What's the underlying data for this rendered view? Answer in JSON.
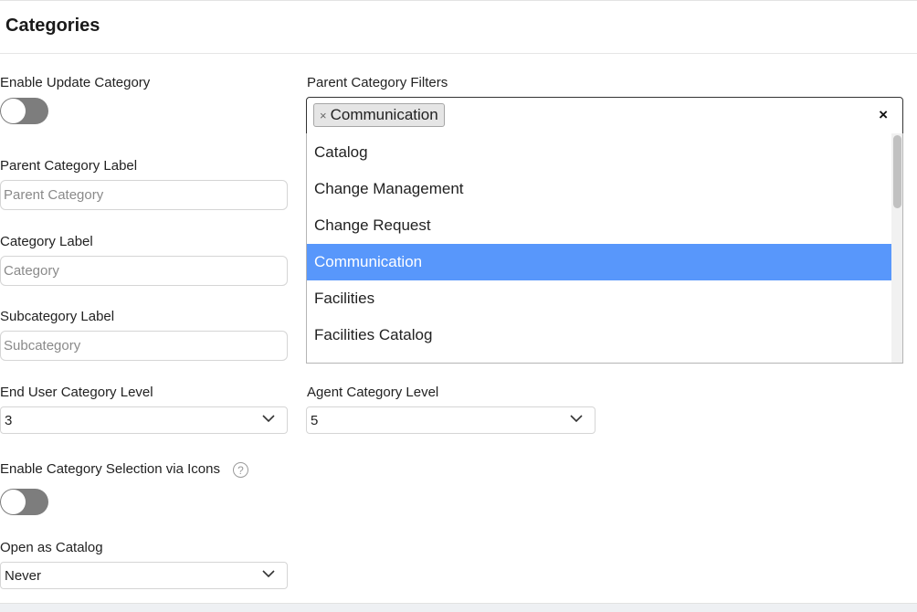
{
  "header": {
    "title": "Categories"
  },
  "enable_update_category": {
    "label": "Enable Update Category",
    "enabled": false
  },
  "parent_category_label": {
    "label": "Parent Category Label",
    "placeholder": "Parent Category",
    "value": ""
  },
  "category_label": {
    "label": "Category Label",
    "placeholder": "Category",
    "value": ""
  },
  "subcategory_label": {
    "label": "Subcategory Label",
    "placeholder": "Subcategory",
    "value": ""
  },
  "end_user_category_level": {
    "label": "End User Category Level",
    "value": "3"
  },
  "agent_category_level": {
    "label": "Agent Category Level",
    "value": "5"
  },
  "enable_category_selection_icons": {
    "label": "Enable Category Selection via Icons",
    "help_glyph": "?",
    "enabled": false
  },
  "open_as_catalog": {
    "label": "Open as Catalog",
    "value": "Never"
  },
  "parent_category_filters": {
    "label": "Parent Category Filters",
    "selected_chips": [
      {
        "label": "Communication",
        "remove_glyph": "×"
      }
    ],
    "clear_glyph": "×",
    "options": [
      {
        "label": "Catalog",
        "highlighted": false
      },
      {
        "label": "Change Management",
        "highlighted": false
      },
      {
        "label": "Change Request",
        "highlighted": false
      },
      {
        "label": "Communication",
        "highlighted": true
      },
      {
        "label": "Facilities",
        "highlighted": false
      },
      {
        "label": "Facilities Catalog",
        "highlighted": false
      }
    ]
  },
  "colors": {
    "highlight": "#5897fb",
    "toggle_off": "#7d7d7d"
  }
}
